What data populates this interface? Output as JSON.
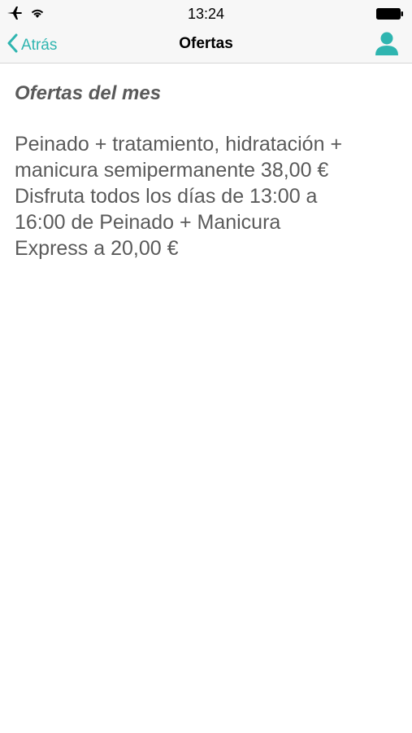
{
  "status_bar": {
    "time": "13:24",
    "icons": [
      "airplane-icon",
      "wifi-icon",
      "battery-icon"
    ]
  },
  "nav_bar": {
    "back_label": "Atrás",
    "title": "Ofertas",
    "profile_icon": "person-icon"
  },
  "content": {
    "section_title": "Ofertas del mes",
    "offer_text": "Peinado + tratamiento, hidratación +\nmanicura semipermanente 38,00 €\nDisfruta todos los días de 13:00 a\n16:00 de Peinado + Manicura\nExpress a 20,00 €"
  },
  "colors": {
    "accent": "#2fb5b0",
    "text": "#5a5a5a",
    "bar_background": "#f7f7f7"
  }
}
